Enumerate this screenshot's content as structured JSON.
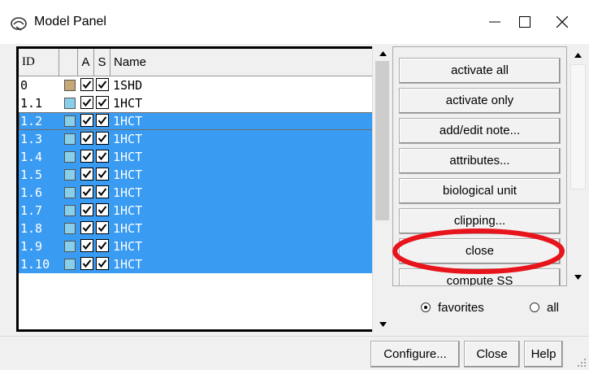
{
  "window": {
    "title": "Model Panel",
    "controls": [
      "minimize",
      "maximize",
      "close"
    ]
  },
  "table": {
    "columns": [
      "ID",
      "",
      "A",
      "S",
      "Name"
    ],
    "rows": [
      {
        "id": "0",
        "color": "#c8a876",
        "active": true,
        "shown": true,
        "name": "1SHD",
        "selected": false
      },
      {
        "id": "1.1",
        "color": "#87cfeb",
        "active": true,
        "shown": true,
        "name": "1HCT",
        "selected": false
      },
      {
        "id": "1.2",
        "color": "#87cfeb",
        "active": true,
        "shown": true,
        "name": "1HCT",
        "selected": true,
        "focused": true
      },
      {
        "id": "1.3",
        "color": "#87cfeb",
        "active": true,
        "shown": true,
        "name": "1HCT",
        "selected": true
      },
      {
        "id": "1.4",
        "color": "#87cfeb",
        "active": true,
        "shown": true,
        "name": "1HCT",
        "selected": true
      },
      {
        "id": "1.5",
        "color": "#87cfeb",
        "active": true,
        "shown": true,
        "name": "1HCT",
        "selected": true
      },
      {
        "id": "1.6",
        "color": "#87cfeb",
        "active": true,
        "shown": true,
        "name": "1HCT",
        "selected": true
      },
      {
        "id": "1.7",
        "color": "#87cfeb",
        "active": true,
        "shown": true,
        "name": "1HCT",
        "selected": true
      },
      {
        "id": "1.8",
        "color": "#87cfeb",
        "active": true,
        "shown": true,
        "name": "1HCT",
        "selected": true
      },
      {
        "id": "1.9",
        "color": "#87cfeb",
        "active": true,
        "shown": true,
        "name": "1HCT",
        "selected": true
      },
      {
        "id": "1.10",
        "color": "#87cfeb",
        "active": true,
        "shown": true,
        "name": "1HCT",
        "selected": true
      }
    ]
  },
  "commands": [
    "activate all",
    "activate only",
    "add/edit note...",
    "attributes...",
    "biological unit",
    "clipping...",
    "close",
    "compute SS"
  ],
  "highlighted_command": "close",
  "list_filter": {
    "options": [
      "favorites",
      "all"
    ],
    "selected": "favorites"
  },
  "footer": {
    "configure_label": "Configure...",
    "close_label": "Close",
    "help_label": "Help"
  },
  "colors": {
    "selection": "#3a9bf2",
    "highlight_ring": "#e8141c"
  },
  "icons": {
    "app": "model-panel-app-icon",
    "checkbox": "checkmark-icon"
  }
}
